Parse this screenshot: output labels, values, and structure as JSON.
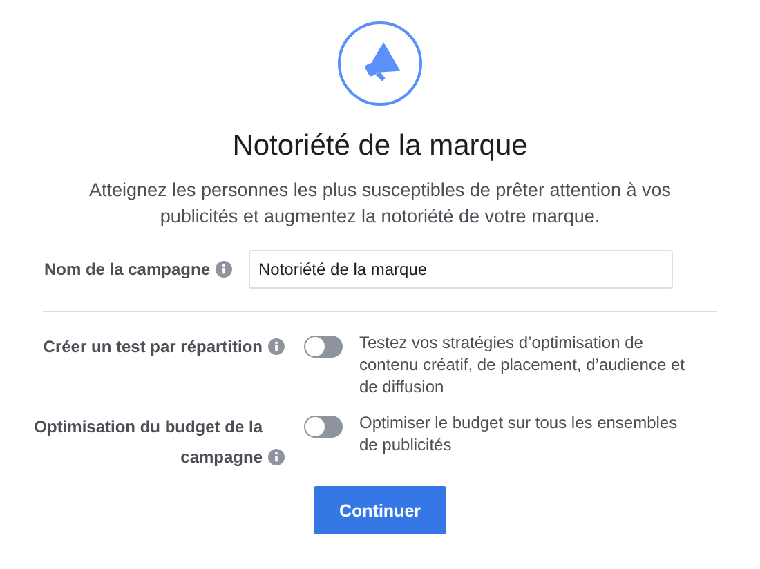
{
  "title": "Notoriété de la marque",
  "subtitle": "Atteignez les personnes les plus susceptibles de prêter attention à vos publicités et augmentez la notoriété de votre marque.",
  "campaign_name": {
    "label": "Nom de la campagne",
    "value": "Notoriété de la marque"
  },
  "options": [
    {
      "label": "Créer un test par répartition",
      "on": false,
      "description": "Testez vos stratégies d’optimisation de contenu créatif, de placement, d’audience et de diffusion"
    },
    {
      "label": "Optimisation du budget de la campagne",
      "on": false,
      "description": "Optimiser le budget sur tous les ensembles de publicités"
    }
  ],
  "button": "Continuer"
}
